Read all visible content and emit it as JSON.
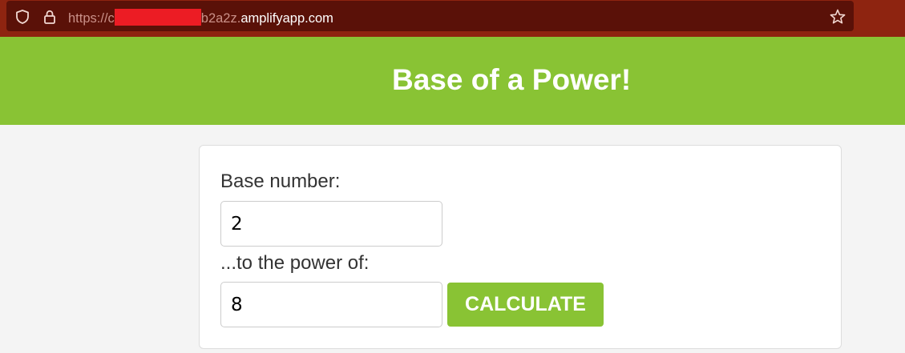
{
  "browser": {
    "url_prefix": "https://",
    "url_partial_visible": "b2a2z.",
    "url_domain": "amplifyapp.com"
  },
  "header": {
    "title": "Base of a Power!"
  },
  "form": {
    "base_label": "Base number:",
    "base_value": "2",
    "power_label": "...to the power of:",
    "power_value": "8",
    "calculate_label": "CALCULATE"
  },
  "colors": {
    "accent_green": "#89c334",
    "browser_bar": "#8e2410",
    "redaction": "#ec1c24"
  }
}
